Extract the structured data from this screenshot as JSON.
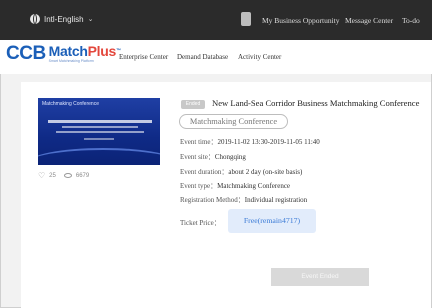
{
  "topbar": {
    "language": "Intl-English",
    "links": [
      "My Business Opportunity",
      "Message Center",
      "To-do"
    ]
  },
  "logo": {
    "ccb": "CCB",
    "match": "Match",
    "plus": "Plus",
    "suffix": "™",
    "subtitle": "Smart Matchmaking Platform"
  },
  "nav": {
    "items": [
      "Enterprise Center",
      "Demand Database",
      "Activity Center"
    ]
  },
  "event": {
    "thumbnail_caption": "Matchmaking Conference",
    "likes": "25",
    "views": "6679",
    "status_badge": "Ended",
    "title": "New Land-Sea Corridor Business Matchmaking Conference",
    "tag": "Matchmaking Conference",
    "time_label": "Event time：",
    "time_value": "2019-11-02 13:30-2019-11-05 11:40",
    "site_label": "Event site：",
    "site_value": "Chongqing",
    "duration_label": "Event duration：",
    "duration_value": "about 2 day (on-site basis)",
    "type_label": "Event type：",
    "type_value": "Matchmaking Conference",
    "registration_label": "Registration Method：",
    "registration_value": "Individual registration",
    "price_label": "Ticket Price：",
    "price_value": "Free(remain4717)",
    "end_button": "Event Ended"
  },
  "colors": {
    "topbar_bg": "#2b2b2b",
    "brand_blue": "#1b5fb8",
    "brand_red": "#e3473c",
    "price_bg": "#e2ecfb",
    "price_text": "#3a7ad6"
  }
}
